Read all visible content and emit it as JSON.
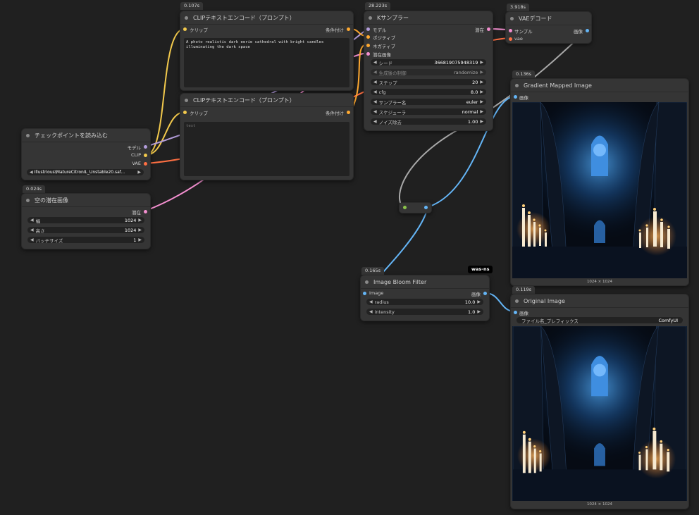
{
  "colors": {
    "clip_wire": "#f2c94c",
    "model_wire": "#b39ddb",
    "vae_wire": "#ff7043",
    "latent_wire": "#f48fd0",
    "conditioning_wire": "#ffa931",
    "image_wire": "#64b5f6",
    "reroute_wire": "#a8a8a8"
  },
  "nodes": {
    "clip_pos": {
      "time": "0.107s",
      "title": "CLIPテキストエンコード（プロンプト）",
      "input_clip": "クリップ",
      "output": "条件付け",
      "text": "A photo realistic dark eerie cathedral with bright candles illuminating the dark space"
    },
    "clip_neg": {
      "title": "CLIPテキストエンコード（プロンプト）",
      "input_clip": "クリップ",
      "output": "条件付け",
      "placeholder": "text"
    },
    "checkpoint": {
      "title": "チェックポイントを読み込む",
      "out_model": "モデル",
      "out_clip": "CLIP",
      "out_vae": "VAE",
      "ckpt_name": "Illustrious\\MatureCitronIL_Unstable20.saf..."
    },
    "empty_latent": {
      "time": "0.024s",
      "title": "空の潜在画像",
      "output": "潜在",
      "w_label": "幅",
      "w_value": "1024",
      "h_label": "高さ",
      "h_value": "1024",
      "b_label": "バッチサイズ",
      "b_value": "1"
    },
    "ksampler": {
      "time": "28.223s",
      "title": "Kサンプラー",
      "in_model": "モデル",
      "in_positive": "ポジティブ",
      "in_negative": "ネガティブ",
      "in_latent": "潜在画像",
      "output": "潜在",
      "seed_label": "シード",
      "seed_value": "366819075948319",
      "control_label": "生成後の制御",
      "control_value": "randomize",
      "steps_label": "ステップ",
      "steps_value": "20",
      "cfg_label": "cfg",
      "cfg_value": "8.0",
      "sampler_label": "サンプラー名",
      "sampler_value": "euler",
      "scheduler_label": "スケジューラ",
      "scheduler_value": "normal",
      "denoise_label": "ノイズ除去",
      "denoise_value": "1.00"
    },
    "vae_decode": {
      "time": "3.918s",
      "title": "VAEデコード",
      "in_samples": "サンプル",
      "in_vae": "vae",
      "output": "画像"
    },
    "gradient": {
      "time": "0.136s",
      "title": "Gradient Mapped Image",
      "input": "画像",
      "caption": "1024 × 1024"
    },
    "bloom": {
      "time": "0.165s",
      "tag": "was-ns",
      "title": "Image Bloom Filter",
      "input": "Image",
      "output": "画像",
      "radius_label": "radius",
      "radius_value": "10.0",
      "intensity_label": "intensity",
      "intensity_value": "1.0"
    },
    "original": {
      "time": "0.119s",
      "title": "Original Image",
      "input": "画像",
      "prefix_label": "ファイル名_プレフィックス",
      "prefix_value": "ComfyUI",
      "caption": "1024 × 1024"
    }
  }
}
